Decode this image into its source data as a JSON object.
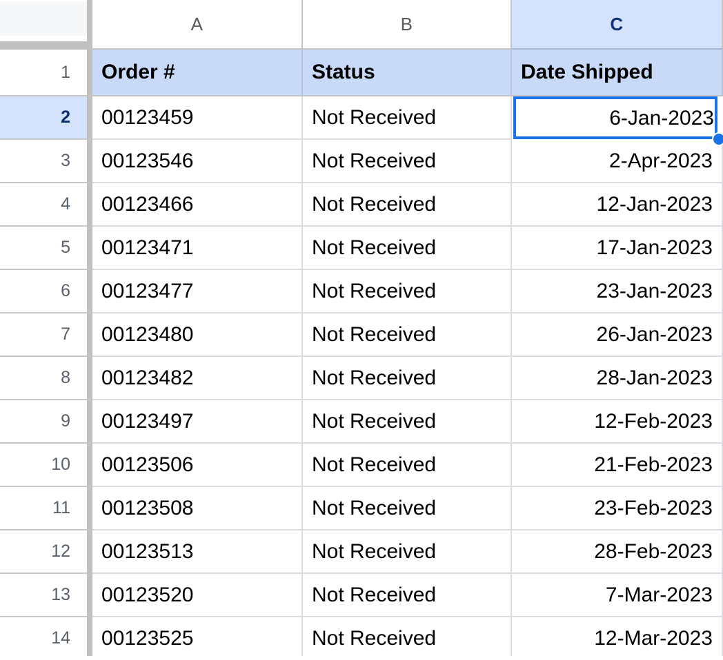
{
  "app": {
    "type": "spreadsheet",
    "accent_color": "#1a73e8",
    "header_fill_color": "#c9daf8",
    "selected_header_color": "#d5e2fb"
  },
  "corner": {
    "label": ""
  },
  "columns": [
    {
      "id": "A",
      "label": "A",
      "selected": false
    },
    {
      "id": "B",
      "label": "B",
      "selected": false
    },
    {
      "id": "C",
      "label": "C",
      "selected": true
    }
  ],
  "selection": {
    "active_cell": "C2",
    "active_cell_value": "6-Jan-2023",
    "selected_column": "C",
    "selected_row": "2",
    "fill_handle": "fill-handle"
  },
  "header_row": {
    "row_number": "1",
    "cells": [
      "Order #",
      "Status",
      "Date Shipped"
    ]
  },
  "rows": [
    {
      "row_number": "2",
      "order": "00123459",
      "status": "Not Received",
      "date": "6-Jan-2023",
      "selected": true
    },
    {
      "row_number": "3",
      "order": "00123546",
      "status": "Not Received",
      "date": "2-Apr-2023",
      "selected": false
    },
    {
      "row_number": "4",
      "order": "00123466",
      "status": "Not Received",
      "date": "12-Jan-2023",
      "selected": false
    },
    {
      "row_number": "5",
      "order": "00123471",
      "status": "Not Received",
      "date": "17-Jan-2023",
      "selected": false
    },
    {
      "row_number": "6",
      "order": "00123477",
      "status": "Not Received",
      "date": "23-Jan-2023",
      "selected": false
    },
    {
      "row_number": "7",
      "order": "00123480",
      "status": "Not Received",
      "date": "26-Jan-2023",
      "selected": false
    },
    {
      "row_number": "8",
      "order": "00123482",
      "status": "Not Received",
      "date": "28-Jan-2023",
      "selected": false
    },
    {
      "row_number": "9",
      "order": "00123497",
      "status": "Not Received",
      "date": "12-Feb-2023",
      "selected": false
    },
    {
      "row_number": "10",
      "order": "00123506",
      "status": "Not Received",
      "date": "21-Feb-2023",
      "selected": false
    },
    {
      "row_number": "11",
      "order": "00123508",
      "status": "Not Received",
      "date": "23-Feb-2023",
      "selected": false
    },
    {
      "row_number": "12",
      "order": "00123513",
      "status": "Not Received",
      "date": "28-Feb-2023",
      "selected": false
    },
    {
      "row_number": "13",
      "order": "00123520",
      "status": "Not Received",
      "date": "7-Mar-2023",
      "selected": false
    },
    {
      "row_number": "14",
      "order": "00123525",
      "status": "Not Received",
      "date": "12-Mar-2023",
      "selected": false
    }
  ]
}
